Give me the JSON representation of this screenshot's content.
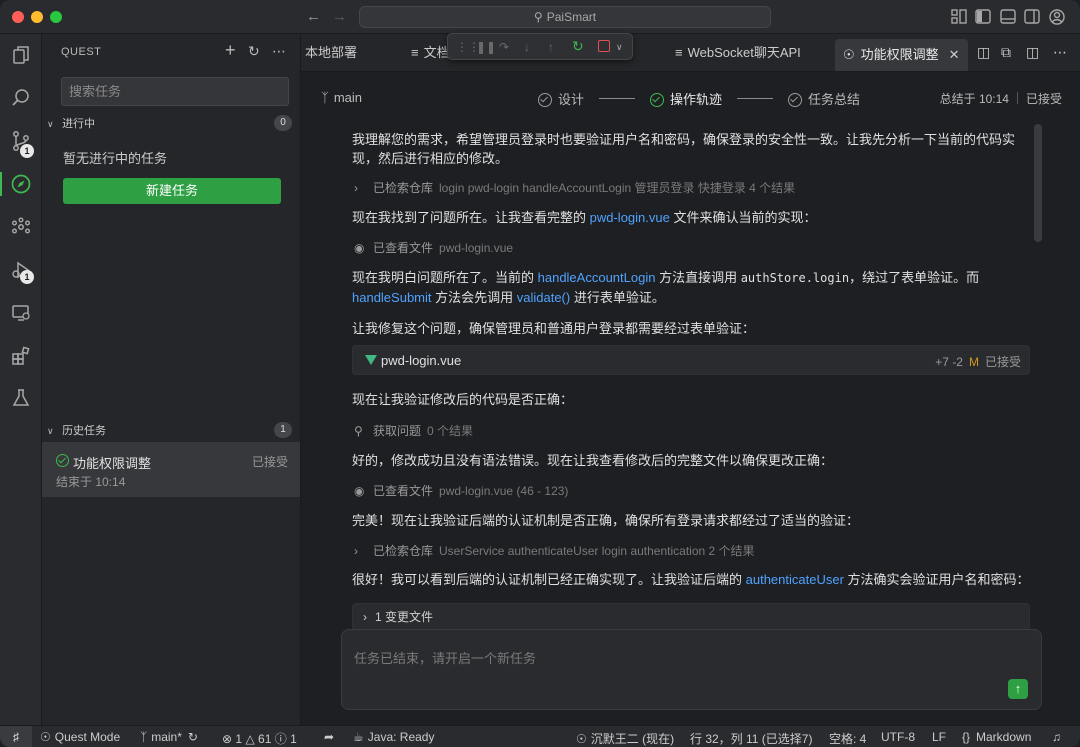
{
  "window": {
    "title": "PaiSmart"
  },
  "sidebar": {
    "title": "QUEST",
    "search_placeholder": "搜索任务",
    "in_progress": {
      "label": "进行中",
      "count": "0",
      "empty_text": "暂无进行中的任务",
      "new_task_label": "新建任务"
    },
    "history": {
      "label": "历史任务",
      "count": "1",
      "items": [
        {
          "title": "功能权限调整",
          "status": "已接受",
          "time": "结束于 10:14"
        }
      ]
    }
  },
  "activity_badges": {
    "source_control": "1",
    "run_debug": "1"
  },
  "tabs": [
    {
      "label": "本地部署"
    },
    {
      "label": "文档"
    },
    {
      "label": "WebSocket聊天API"
    },
    {
      "label": "功能权限调整",
      "active": true
    }
  ],
  "header": {
    "branch": "main",
    "steps": [
      "设计",
      "操作轨迹",
      "任务总结"
    ],
    "summary_time": "总结于 10:14",
    "summary_status": "已接受"
  },
  "conversation": {
    "m1": "我理解您的需求，希望管理员登录时也要验证用户名和密码，确保登录的安全性一致。让我先分析一下当前的代码实现，然后进行相应的修改。",
    "t1": {
      "label": "已检索仓库",
      "detail": "login pwd-login handleAccountLogin 管理员登录 快捷登录 4 个结果"
    },
    "m2_a": "现在我找到了问题所在。让我查看完整的 ",
    "m2_link": "pwd-login.vue",
    "m2_b": " 文件来确认当前的实现：",
    "t2": {
      "label": "已查看文件",
      "detail": "pwd-login.vue"
    },
    "m3_a": "现在我明白问题所在了。当前的 ",
    "m3_link1": "handleAccountLogin",
    "m3_b": " 方法直接调用 ",
    "m3_code": "authStore.login",
    "m3_c": "，绕过了表单验证。而",
    "m3_link2": "handleSubmit",
    "m3_d": " 方法会先调用 ",
    "m3_link3": "validate()",
    "m3_e": " 进行表单验证。",
    "m4": "让我修复这个问题，确保管理员和普通用户登录都需要经过表单验证：",
    "file_card": {
      "name": "pwd-login.vue",
      "diff": "+7 -2",
      "mark": "M",
      "status": "已接受"
    },
    "m5": "现在让我验证修改后的代码是否正确：",
    "t3": {
      "label": "获取问题",
      "detail": "0 个结果"
    },
    "m6": "好的，修改成功且没有语法错误。现在让我查看修改后的完整文件以确保更改正确：",
    "t4": {
      "label": "已查看文件",
      "detail": "pwd-login.vue (46 - 123)"
    },
    "m7": "完美！现在让我验证后端的认证机制是否正确，确保所有登录请求都经过了适当的验证：",
    "t5": {
      "label": "已检索仓库",
      "detail": "UserService authenticateUser login authentication 2 个结果"
    },
    "m8_a": "很好！我可以看到后端的认证机制已经正确实现了。让我验证后端的 ",
    "m8_link": "authenticateUser",
    "m8_b": " 方法确实会验证用户名和密码：",
    "changed_files": "1 变更文件"
  },
  "input": {
    "placeholder": "任务已结束，请开启一个新任务"
  },
  "statusbar": {
    "mode": "Quest Mode",
    "branch": "main*",
    "errors": "1",
    "warnings": "61",
    "infos": "1",
    "java": "Java: Ready",
    "user": "沉默王二 (现在)",
    "cursor": "行 32，列 11 (已选择7)",
    "spaces": "空格: 4",
    "encoding": "UTF-8",
    "eol": "LF",
    "language": "Markdown"
  },
  "colors": {
    "accent_green": "#2ea043",
    "link_blue": "#4fa3ff",
    "modified": "#d29922"
  }
}
